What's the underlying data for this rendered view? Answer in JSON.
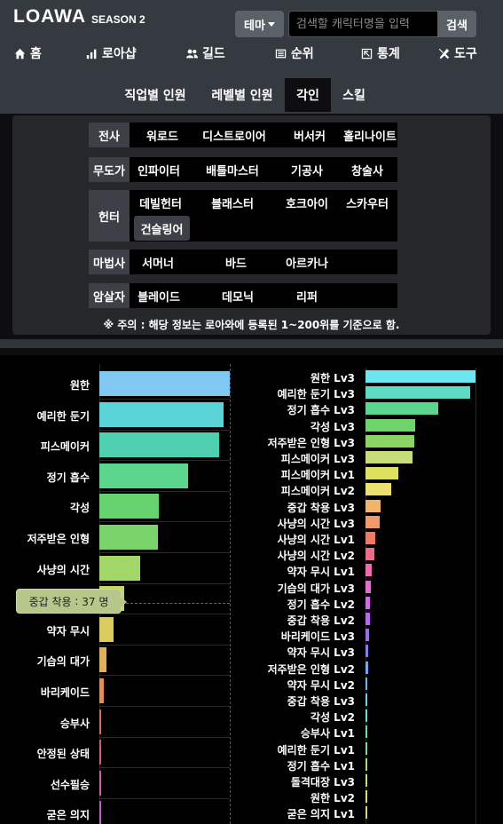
{
  "header": {
    "logo": "LOAWA",
    "season": "SEASON 2",
    "theme_label": "테마",
    "search_placeholder": "검색할 캐릭터명을 입력",
    "search_button": "검색"
  },
  "nav": [
    {
      "label": "홈",
      "icon": "home-icon"
    },
    {
      "label": "로아샵",
      "icon": "bar-chart-icon"
    },
    {
      "label": "길드",
      "icon": "users-icon"
    },
    {
      "label": "순위",
      "icon": "list-icon"
    },
    {
      "label": "통계",
      "icon": "stats-icon"
    },
    {
      "label": "도구",
      "icon": "tools-icon"
    }
  ],
  "tabs": [
    {
      "label": "직업별 인원",
      "active": false
    },
    {
      "label": "레벨별 인원",
      "active": false
    },
    {
      "label": "각인",
      "active": true
    },
    {
      "label": "스킬",
      "active": false
    }
  ],
  "classes": [
    {
      "group": "전사",
      "items": [
        "워로드",
        "디스트로이어",
        "버서커",
        "홀리나이트"
      ]
    },
    {
      "group": "무도가",
      "items": [
        "인파이터",
        "배틀마스터",
        "기공사",
        "창술사"
      ]
    },
    {
      "group": "헌터",
      "items": [
        "데빌헌터",
        "블래스터",
        "호크아이",
        "스카우터",
        "건슬링어"
      ],
      "selected": "건슬링어"
    },
    {
      "group": "마법사",
      "items": [
        "서머너",
        "바드",
        "아르카나"
      ]
    },
    {
      "group": "암살자",
      "items": [
        "블레이드",
        "데모닉",
        "리퍼"
      ]
    }
  ],
  "note": "※ 주의 : 해당 정보는 로아와에 등록된 1~200위를 기준으로 함.",
  "tooltip": {
    "label": "중갑 착용",
    "value": "37 명"
  },
  "chart_data": [
    {
      "type": "bar",
      "orientation": "horizontal",
      "categories": [
        "원한",
        "예리한 둔기",
        "피스메이커",
        "정기 흡수",
        "각성",
        "저주받은 인형",
        "사냥의 시간",
        "중갑 착용",
        "약자 무시",
        "기습의 대가",
        "바리케이드",
        "승부사",
        "안정된 상태",
        "선수필승",
        "굳은 의지"
      ],
      "values": [
        195,
        186,
        179,
        133,
        89,
        87,
        61,
        37,
        21,
        10,
        7,
        3,
        3,
        2,
        2
      ],
      "colors": [
        "#7ec8f2",
        "#5ad4d6",
        "#4ed0b0",
        "#5cd68f",
        "#66d46e",
        "#7ad46a",
        "#a2d868",
        "#c8d466",
        "#dccb5e",
        "#e0b15c",
        "#e08f5c",
        "#d96a5a",
        "#d65a7c",
        "#d55aa8",
        "#c35ad2"
      ]
    },
    {
      "type": "bar",
      "orientation": "horizontal",
      "categories": [
        "원한 Lv3",
        "예리한 둔기 Lv3",
        "정기 흡수 Lv3",
        "각성 Lv3",
        "저주받은 인형 Lv3",
        "피스메이커 Lv3",
        "피스메이커 Lv1",
        "피스메이커 Lv2",
        "중갑 착용 Lv3",
        "사냥의 시간 Lv3",
        "사냥의 시간 Lv1",
        "사냥의 시간 Lv2",
        "약자 무시 Lv1",
        "기습의 대가 Lv3",
        "정기 흡수 Lv2",
        "중갑 착용 Lv2",
        "바리케이드 Lv3",
        "약자 무시 Lv3",
        "저주받은 인형 Lv2",
        "약자 무시 Lv2",
        "중갑 착용 Lv3",
        "각성 Lv2",
        "승부사 Lv1",
        "예리한 둔기 Lv1",
        "정기 흡수 Lv1",
        "돌격대장 Lv3",
        "원한 Lv2",
        "굳은 의지 Lv1"
      ],
      "values": [
        193,
        184,
        127,
        87,
        85,
        82,
        57,
        45,
        27,
        25,
        17,
        15,
        11,
        10,
        8,
        8,
        7,
        5,
        4,
        3,
        3,
        2,
        2,
        2,
        2,
        1,
        1,
        1
      ],
      "colors": [
        "#6ee6f0",
        "#5ddbc4",
        "#5cd68f",
        "#6fd46a",
        "#8ad466",
        "#c8dc7a",
        "#e0e060",
        "#eee070",
        "#f0b46a",
        "#f09a6a",
        "#f07a6a",
        "#f06a8a",
        "#f06ab4",
        "#e86ad2",
        "#d46ae6",
        "#b96aec",
        "#9f6af0",
        "#8a7af0",
        "#7aa0f0",
        "#6ab8f0",
        "#6ad0f0",
        "#6ae0c8",
        "#6ae0a0",
        "#7ae08a",
        "#9ae07a",
        "#b8e07a",
        "#d8e07a",
        "#e0d07a"
      ]
    }
  ]
}
